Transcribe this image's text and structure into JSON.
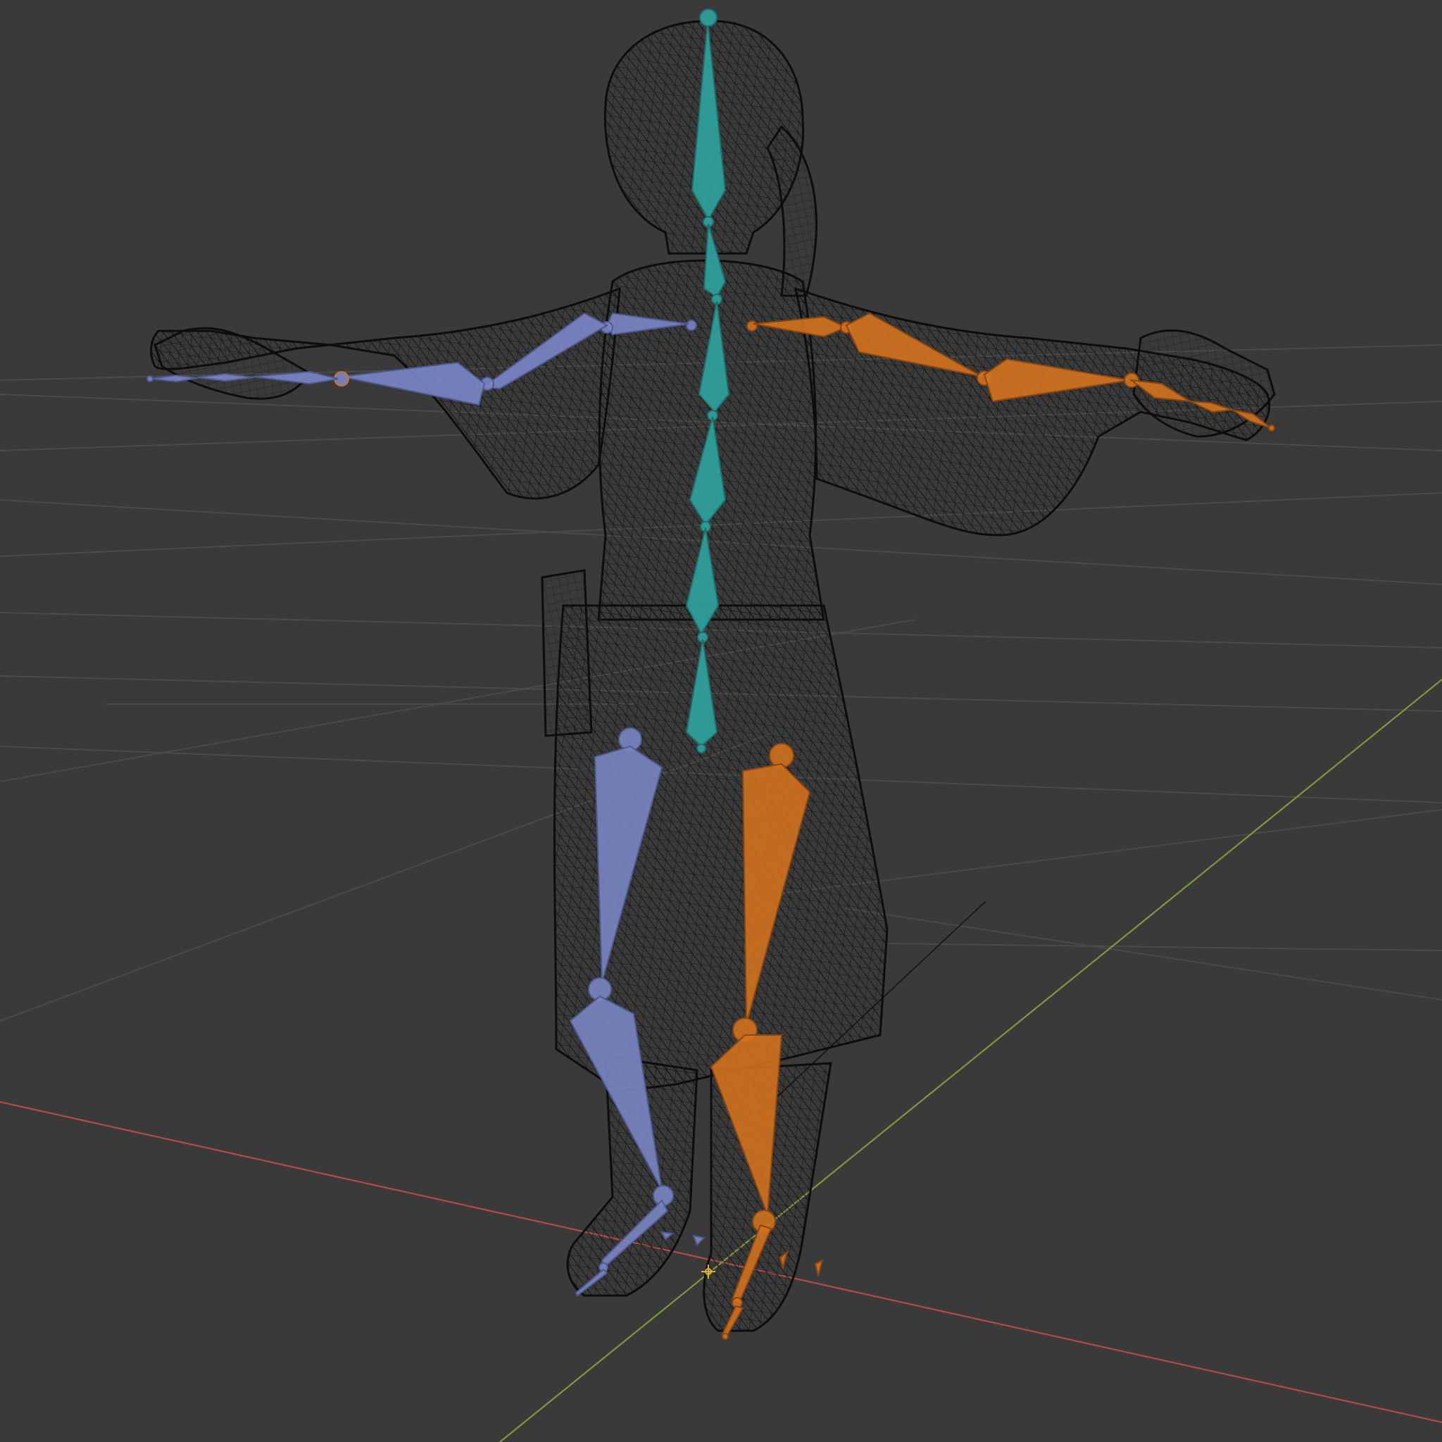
{
  "viewport": {
    "mode": "3D viewport",
    "shading": "wireframe",
    "background_color": "#3a3a3a",
    "grid_color": "#4a4a4a",
    "axis_x_color": "#b34a4a",
    "axis_y_color": "#7d9a3a"
  },
  "mesh": {
    "name_icon": "character-mesh-icon",
    "wire_color": "#111111"
  },
  "armature": {
    "spine_color": "#2fa39d",
    "left_side_color": "#7a86c4",
    "right_side_color": "#d0721f",
    "bone_count": 28
  }
}
